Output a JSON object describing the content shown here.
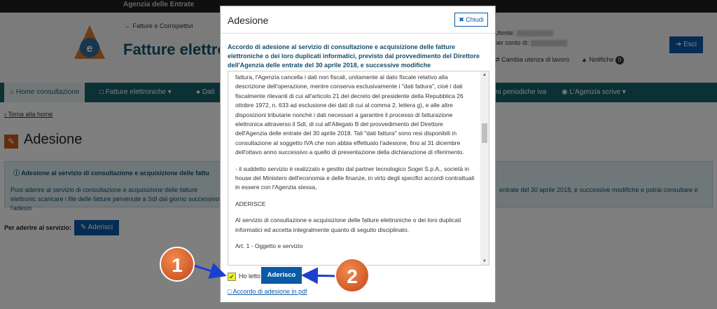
{
  "topbar": {
    "agency": "Agenzia delle Entrate"
  },
  "header": {
    "breadcrumb": "Fatture e Corrispettivi",
    "app_title": "Fatture elettron",
    "user_label": "Utente:",
    "partita_label": "per conto di:",
    "change_utenza": "Cambia utenza di lavoro",
    "notifiche": "Notifiche",
    "notifiche_count": "0",
    "esci": "Esci"
  },
  "nav": {
    "home": "Home consultazione",
    "fatture": "Fatture elettroniche",
    "dati": "Dati",
    "liquidazioni": "ni periodiche iva",
    "agenzia": "L'Agenzia scrive"
  },
  "page": {
    "back": "Torna alla home",
    "title": "Adesione",
    "info_title": "Adesione al servizio di consultazione e acquisizione delle fattu",
    "info_left": "Puoi aderire al servizio di consultazione e acquisizione delle fatture elettronic scaricare i file delle fatture pervenute a SdI dal giorno successivo l'adesio",
    "info_right": "entrate del 30 aprile 2018, e successive modifiche e potrai consultare e",
    "per_aderire": "Per aderire al servizio:",
    "aderisci": "Aderisci"
  },
  "modal": {
    "title": "Adesione",
    "close": "Chiudi",
    "heading": "Accordo di adesione al servizio di consultazione e acquisizione delle fatture elettroniche o dei loro duplicati informatici, previsto dal provvedimento del Direttore dell'Agenzia delle entrate del 30 aprile 2018, e successive modifiche",
    "body_p1": "fattura, l'Agenzia cancella i dati non fiscali, unitamente al dato fiscale relativo alla descrizione dell'operazione, mentre conserva esclusivamente i \"dati fattura\", cioè i dati fiscalmente rilevanti di cui all'articolo 21 del decreto del presidente della Repubblica 26 ottobre 1972, n. 633 ad esclusione dei dati di cui al comma 2, lettera g), e alle altre disposizioni tributarie nonché i dati necessari a garantire il processo di fatturazione elettronica attraverso il SdI, di cui all'Allegato B del provvedimento del Direttore dell'Agenzia delle entrate del 30 aprile 2018. Tali \"dati fattura\" sono resi disponibili in consultazione al soggetto IVA che non abbia effettuato l'adesione, fino al 31 dicembre dell'ottavo anno successivo a quello di presentazione della dichiarazione di riferimento.",
    "body_p2": "- il suddetto servizio è realizzato e gestito dal partner tecnologico Sogei S.p.A., società in house del Ministero dell'economia e delle finanze, in virtù degli specifici accordi contrattuali in essere con l'Agenzia stessa,",
    "body_p3": "ADERISCE",
    "body_p4": "Al servizio di consultazione e acquisizione delle fatture elettroniche o dei loro duplicati informatici ed accetta integralmente quanto di seguito disciplinato.",
    "body_p5": "Art. 1 - Oggetto e servizio",
    "ho_letto": "Ho letto",
    "aderisco": "Aderisco",
    "pdf_link": "Accordo di adesione in pdf"
  },
  "callouts": {
    "first": "1",
    "second": "2"
  },
  "colors": {
    "nav": "#16636b",
    "primary": "#0a5aa8",
    "callout": "#d9561f",
    "highlight": "#f6ee1a"
  }
}
